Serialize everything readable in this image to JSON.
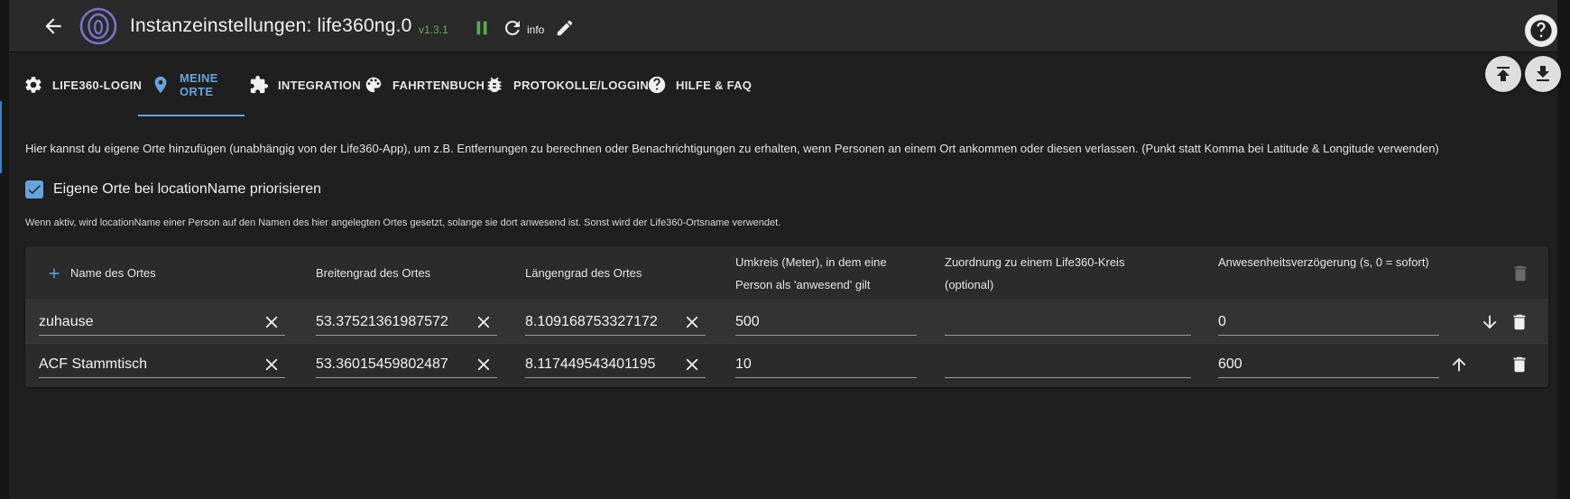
{
  "header": {
    "title": "Instanzeinstellungen: life360ng.0",
    "version": "v1.3.1",
    "log_level": "info",
    "icons": [
      "arrow-back-icon",
      "life360-logo",
      "pause-icon",
      "reload-icon",
      "edit-icon",
      "help-icon"
    ]
  },
  "tabs": [
    {
      "label": "LIFE360-LOGIN",
      "icon": "gear-icon"
    },
    {
      "label": "MEINE ORTE",
      "icon": "location-pin-icon"
    },
    {
      "label": "INTEGRATION",
      "icon": "puzzle-icon"
    },
    {
      "label": "FAHRTENBUCH",
      "icon": "palette-icon"
    },
    {
      "label": "PROTOKOLLE/LOGGING",
      "icon": "bug-icon"
    },
    {
      "label": "HILFE & FAQ",
      "icon": "help-circle-icon"
    }
  ],
  "active_tab": "MEINE ORTE",
  "content": {
    "description": "Hier kannst du eigene Orte hinzufügen (unabhängig von der Life360-App), um z.B. Entfernungen zu berechnen oder Benachrichtigungen zu erhalten, wenn Personen an einem Ort ankommen oder diesen verlassen. (Punkt statt Komma bei Latitude & Longitude verwenden)",
    "checkbox_label": "Eigene Orte bei locationName priorisieren",
    "checkbox_checked": true,
    "hint": "Wenn aktiv, wird locationName einer Person auf den Namen des hier angelegten Ortes gesetzt, solange sie dort anwesend ist. Sonst wird der Life360-Ortsname verwendet."
  },
  "table": {
    "columns": [
      "Name des Ortes",
      "Breitengrad des Ortes",
      "Längengrad des Ortes",
      "Umkreis (Meter), in dem eine Person als 'anwesend' gilt",
      "Zuordnung zu einem Life360-Kreis (optional)",
      "Anwesenheitsverzögerung (s, 0 = sofort)"
    ],
    "rows": [
      {
        "name": "zuhause",
        "lat": "53.37521361987572",
        "lon": "8.109168753327172",
        "radius": "500",
        "circle": "",
        "delay": "0",
        "move": "down"
      },
      {
        "name": "ACF Stammtisch",
        "lat": "53.36015459802487",
        "lon": "8.117449543401195",
        "radius": "10",
        "circle": "",
        "delay": "600",
        "move": "up"
      }
    ]
  },
  "colors": {
    "accent": "#66a3de",
    "background": "#1f1f1f",
    "toolbar": "#2a2a2a",
    "version_green": "#6fa86a"
  }
}
